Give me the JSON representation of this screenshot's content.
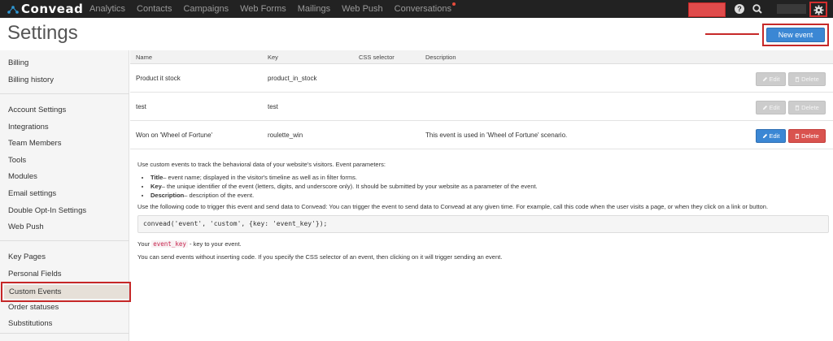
{
  "app": {
    "logo_text": "Convead"
  },
  "nav": {
    "items": [
      "Analytics",
      "Contacts",
      "Campaigns",
      "Web Forms",
      "Mailings",
      "Web Push",
      "Conversations"
    ],
    "help_glyph": "?",
    "icons": [
      "question-circle-icon",
      "search-icon",
      "gear-icon"
    ]
  },
  "header": {
    "title": "Settings",
    "new_event_label": "New event"
  },
  "sidebar": {
    "groups": [
      [
        "Billing",
        "Billing history"
      ],
      [
        "Account Settings",
        "Integrations",
        "Team Members",
        "Tools",
        "Modules",
        "Email settings",
        "Double Opt-In Settings",
        "Web Push"
      ],
      [
        "Key Pages",
        "Personal Fields",
        "Custom Events",
        "Order statuses",
        "Substitutions"
      ]
    ],
    "active": "Custom Events"
  },
  "table": {
    "columns": [
      "Name",
      "Key",
      "CSS selector",
      "Description"
    ],
    "rows": [
      {
        "name": "Product it stock",
        "key": "product_in_stock",
        "css": "",
        "description": "",
        "enabled": false
      },
      {
        "name": "test",
        "key": "test",
        "css": "",
        "description": "",
        "enabled": false
      },
      {
        "name": "Won on 'Wheel of Fortune'",
        "key": "roulette_win",
        "css": "",
        "description": "This event is used in 'Wheel of Fortune' scenario.",
        "enabled": true
      }
    ],
    "edit_label": "Edit",
    "delete_label": "Delete"
  },
  "info": {
    "intro": "Use custom events to track the behavioral data of your website's visitors. Event parameters:",
    "params": [
      {
        "term": "Title",
        "desc": "– event name; displayed in the visitor's timeline as well as in filter forms."
      },
      {
        "term": "Key",
        "desc": "– the unique identifier of the event (letters, digits, and underscore only). It should be submitted by your website as a parameter of the event."
      },
      {
        "term": "Description",
        "desc": "– description of the event."
      }
    ],
    "usage": "Use the following code to trigger this event and send data to Convead: You can trigger the event to send data to Convead at any given time. For example, call this code when the user visits a page, or when they click on a link or button.",
    "code": "convead('event', 'custom', {key: 'event_key'});",
    "your_prefix": "Your",
    "your_code": "event_key",
    "your_suffix": "- key to your event.",
    "footer": "You can send events without inserting code. If you specify the CSS selector of an event, then clicking on it will trigger sending an event."
  },
  "colors": {
    "primary": "#3b87d4",
    "danger": "#d9534f",
    "highlight": "#c62828",
    "nav_bg": "#222222"
  }
}
